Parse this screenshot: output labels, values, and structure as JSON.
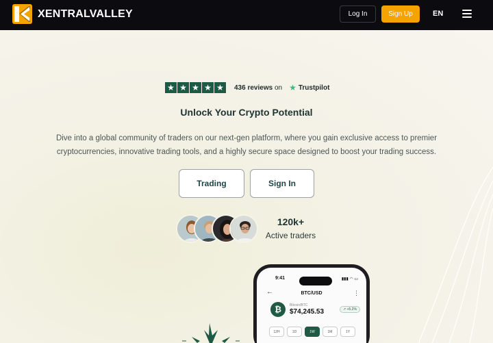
{
  "nav": {
    "brand": "XENTRALVALLEY",
    "login_label": "Log In",
    "signup_label": "Sign Up",
    "language": "EN"
  },
  "trustpilot": {
    "rating_stars": 5,
    "reviews_count": "436 reviews",
    "reviews_on": "on",
    "brand": "Trustpilot"
  },
  "hero": {
    "headline": "Unlock Your Crypto Potential",
    "description": "Dive into a global community of traders on our next-gen platform, where you gain exclusive access to premier cryptocurrencies, innovative trading tools, and a highly secure space designed to boost your trading success.",
    "trading_label": "Trading",
    "signin_label": "Sign In"
  },
  "traders": {
    "count": "120k+",
    "label": "Active traders"
  },
  "phone": {
    "time": "9:41",
    "pair": "BTC/USD",
    "coin_symbol": "₿",
    "coin_sub": "Bitcoin/BTC",
    "price": "$74,245.53",
    "change": "+5.2%",
    "ranges": [
      "12H",
      "1D",
      "1W",
      "1M",
      "1Y"
    ],
    "active_range": "1W"
  },
  "colors": {
    "nav_bg": "#0b0b10",
    "brand_orange": "#f5a300",
    "trust_green": "#1d5a45",
    "background": "#f6f3e8"
  }
}
